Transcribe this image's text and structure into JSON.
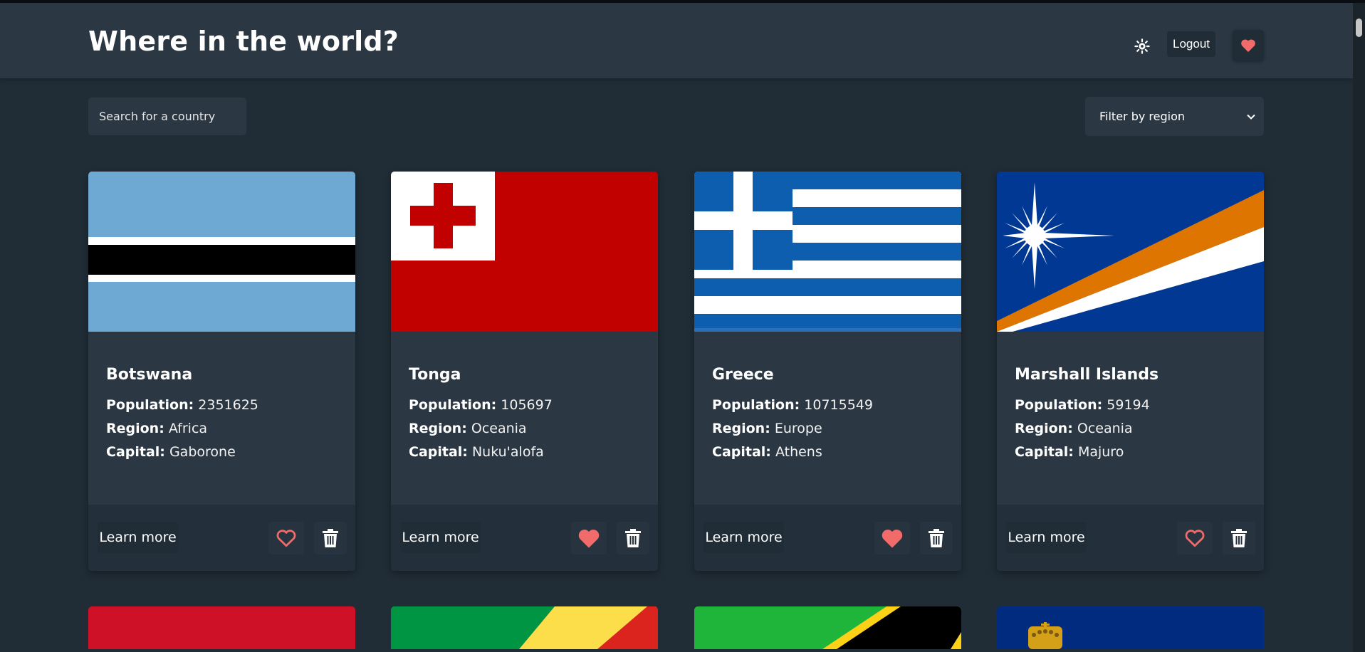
{
  "header": {
    "title": "Where in the world?",
    "logout_label": "Logout",
    "theme_icon": "sun-icon",
    "favorites_icon": "heart-icon"
  },
  "controls": {
    "search_placeholder": "Search for a country",
    "filter_label": "Filter by region"
  },
  "labels": {
    "population": "Population:",
    "region": "Region:",
    "capital": "Capital:",
    "learn_more": "Learn more"
  },
  "countries": [
    {
      "name": "Botswana",
      "population": "2351625",
      "region": "Africa",
      "capital": "Gaborone",
      "favorite": false
    },
    {
      "name": "Tonga",
      "population": "105697",
      "region": "Oceania",
      "capital": "Nuku'alofa",
      "favorite": true
    },
    {
      "name": "Greece",
      "population": "10715549",
      "region": "Europe",
      "capital": "Athens",
      "favorite": true
    },
    {
      "name": "Marshall Islands",
      "population": "59194",
      "region": "Oceania",
      "capital": "Majuro",
      "favorite": false
    }
  ],
  "colors": {
    "background": "#202c36",
    "element": "#2b3743",
    "heart": "#f16b6b",
    "text": "#ffffff"
  }
}
